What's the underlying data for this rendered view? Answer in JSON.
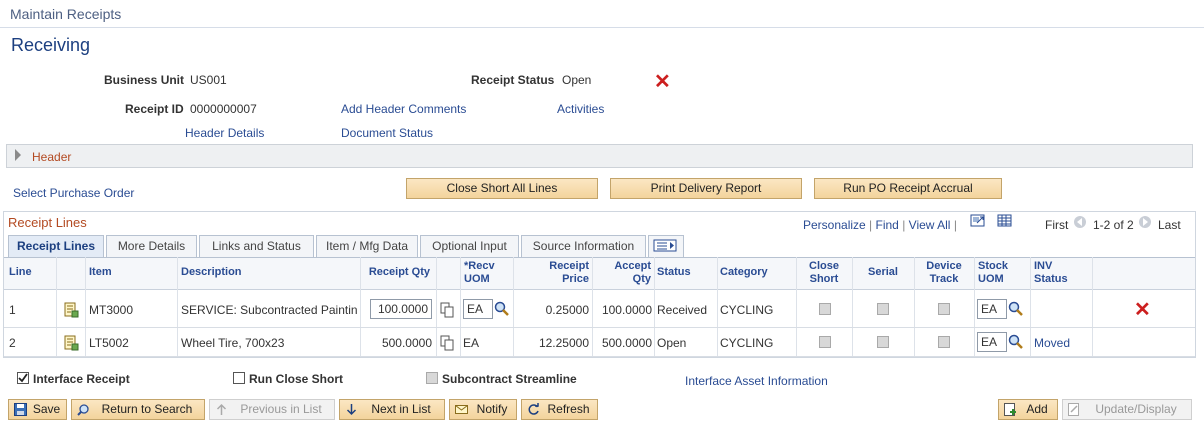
{
  "window": {
    "title": "Maintain Receipts"
  },
  "page": {
    "title": "Receiving"
  },
  "header_fields": {
    "business_unit_label": "Business Unit",
    "business_unit": "US001",
    "receipt_status_label": "Receipt Status",
    "receipt_status": "Open",
    "receipt_id_label": "Receipt ID",
    "receipt_id": "0000000007"
  },
  "links": {
    "add_header_comments": "Add Header Comments",
    "activities": "Activities",
    "header_details": "Header Details",
    "document_status": "Document Status",
    "select_purchase_order": "Select Purchase Order",
    "interface_asset_information": "Interface Asset Information"
  },
  "header_section": {
    "label": "Header"
  },
  "action_buttons": {
    "close_short_all": "Close Short All Lines",
    "print_delivery": "Print Delivery Report",
    "run_accrual": "Run PO Receipt Accrual"
  },
  "grid": {
    "title": "Receipt Lines",
    "personalize": "Personalize",
    "find": "Find",
    "view_all": "View All",
    "first": "First",
    "range": "1-2 of 2",
    "last": "Last",
    "tabs": [
      "Receipt Lines",
      "More Details",
      "Links and Status",
      "Item / Mfg Data",
      "Optional Input",
      "Source Information"
    ],
    "columns": {
      "line": "Line",
      "item": "Item",
      "description": "Description",
      "receipt_qty": "Receipt Qty",
      "recv_uom_1": "*Recv",
      "recv_uom_2": "UOM",
      "receipt_price_1": "Receipt",
      "receipt_price_2": "Price",
      "accept_qty_1": "Accept",
      "accept_qty_2": "Qty",
      "status": "Status",
      "category": "Category",
      "close_short_1": "Close",
      "close_short_2": "Short",
      "serial": "Serial",
      "device_track_1": "Device",
      "device_track_2": "Track",
      "stock_uom_1": "Stock",
      "stock_uom_2": "UOM",
      "inv_status_1": "INV",
      "inv_status_2": "Status"
    },
    "rows": [
      {
        "line": "1",
        "item": "MT3000",
        "description": "SERVICE: Subcontracted Paintin",
        "receipt_qty": "100.0000",
        "recv_uom": "EA",
        "receipt_price": "0.25000",
        "accept_qty": "100.0000",
        "status": "Received",
        "category": "CYCLING",
        "stock_uom": "EA",
        "inv_status": ""
      },
      {
        "line": "2",
        "item": "LT5002",
        "description": "Wheel Tire, 700x23",
        "receipt_qty": "500.0000",
        "recv_uom": "EA",
        "receipt_price": "12.25000",
        "accept_qty": "500.0000",
        "status": "Open",
        "category": "CYCLING",
        "stock_uom": "EA",
        "inv_status": "Moved"
      }
    ]
  },
  "options": {
    "interface_receipt": "Interface Receipt",
    "run_close_short": "Run Close Short",
    "subcontract_streamline": "Subcontract Streamline"
  },
  "toolbar": {
    "save": "Save",
    "return_to_search": "Return to Search",
    "previous_in_list": "Previous in List",
    "next_in_list": "Next in List",
    "notify": "Notify",
    "refresh": "Refresh",
    "add": "Add",
    "update_display": "Update/Display"
  },
  "colors": {
    "link": "#2a4c93",
    "title": "#1c3f80",
    "section": "#b34a22",
    "delete": "#cc1f1f",
    "button": "#f3d49c"
  }
}
